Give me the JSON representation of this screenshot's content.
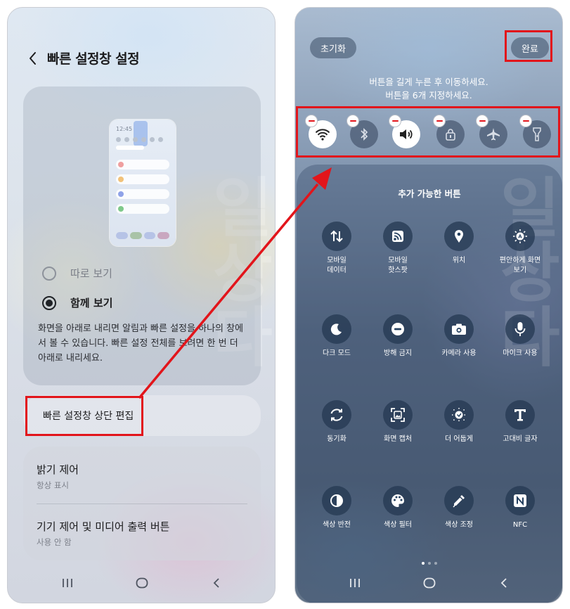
{
  "left_screen": {
    "title": "빠른 설정창 설정",
    "preview": {
      "clock": "12:45"
    },
    "view_options": [
      {
        "label": "따로 보기",
        "selected": false
      },
      {
        "label": "함께 보기",
        "selected": true
      }
    ],
    "description": "화면을 아래로 내리면 알림과 빠른 설정을 하나의 창에서 볼 수 있습니다. 빠른 설정 전체를 보려면 한 번 더 아래로 내리세요.",
    "edit_item": "빠른 설정창 상단 편집",
    "settings": [
      {
        "title": "밝기 제어",
        "subtitle": "항상 표시"
      },
      {
        "title": "기기 제어 및 미디어 출력 버튼",
        "subtitle": "사용 안 함"
      }
    ],
    "watermark": "일\n상\n다"
  },
  "right_screen": {
    "reset_label": "초기화",
    "done_label": "완료",
    "instruction_1": "버튼을 길게 누른 후 이동하세요.",
    "instruction_2": "버튼을 6개 지정하세요.",
    "active_buttons": [
      {
        "icon": "wifi-icon",
        "on": true
      },
      {
        "icon": "bluetooth-icon",
        "on": false
      },
      {
        "icon": "sound-icon",
        "on": true
      },
      {
        "icon": "lock-icon",
        "on": false
      },
      {
        "icon": "airplane-icon",
        "on": false
      },
      {
        "icon": "flashlight-icon",
        "on": false
      }
    ],
    "available_title": "추가 가능한 버튼",
    "available_buttons": [
      {
        "icon": "mobile-data-icon",
        "label": "모바일\n데이터"
      },
      {
        "icon": "hotspot-icon",
        "label": "모바일\n핫스팟"
      },
      {
        "icon": "location-icon",
        "label": "위치"
      },
      {
        "icon": "eye-comfort-icon",
        "label": "편안하게 화면\n보기"
      },
      {
        "icon": "dark-mode-icon",
        "label": "다크 모드"
      },
      {
        "icon": "do-not-disturb-icon",
        "label": "방해 금지"
      },
      {
        "icon": "camera-access-icon",
        "label": "카메라 사용"
      },
      {
        "icon": "microphone-icon",
        "label": "마이크 사용"
      },
      {
        "icon": "sync-icon",
        "label": "동기화"
      },
      {
        "icon": "screen-capture-icon",
        "label": "화면 캡처"
      },
      {
        "icon": "extra-dim-icon",
        "label": "더 어둡게"
      },
      {
        "icon": "high-contrast-font-icon",
        "label": "고대비 글자"
      },
      {
        "icon": "color-inversion-icon",
        "label": "색상 반전"
      },
      {
        "icon": "color-filter-icon",
        "label": "색상 필터"
      },
      {
        "icon": "color-adjust-icon",
        "label": "색상 조정"
      },
      {
        "icon": "nfc-icon",
        "label": "NFC"
      }
    ],
    "watermark": "일\n상\n다"
  },
  "colors": {
    "annotation_red": "#e2151b"
  }
}
